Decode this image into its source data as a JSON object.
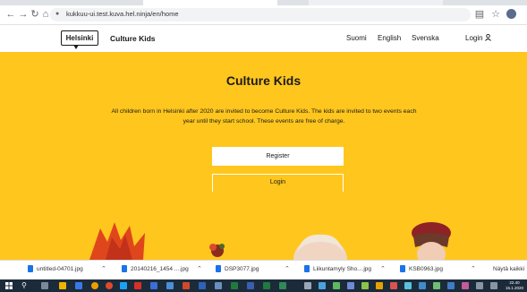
{
  "browser": {
    "url": "kukkuu-ui.test.kuva.hel.ninja/en/home",
    "nav_icons": [
      "back-arrow-icon",
      "forward-arrow-icon",
      "reload-icon",
      "home-icon"
    ],
    "right_icons": [
      "reader-icon",
      "star-icon",
      "profile-icon"
    ]
  },
  "header": {
    "logo": "Helsinki",
    "title": "Culture Kids",
    "languages": [
      "Suomi",
      "English",
      "Svenska"
    ],
    "login": "Login ",
    "login_icon": "user-icon"
  },
  "hero": {
    "title": "Culture Kids",
    "description": "All children born in Helsinki after 2020 are invited to become Culture Kids. The kids are invited to two events each year until they start school. These events are free of charge.",
    "register": "Register",
    "login": "Login",
    "background": "#ffc61e"
  },
  "downloads": {
    "items": [
      "untitled-04701.jpg",
      "20140216_1454 ....jpg",
      "DSP3077.jpg",
      "Liikuntamyly Sho....jpg",
      "KSB0963.jpg"
    ],
    "show_all": "Näytä kaikki"
  },
  "taskbar": {
    "time": "22.40",
    "date": "15.1.2020"
  }
}
